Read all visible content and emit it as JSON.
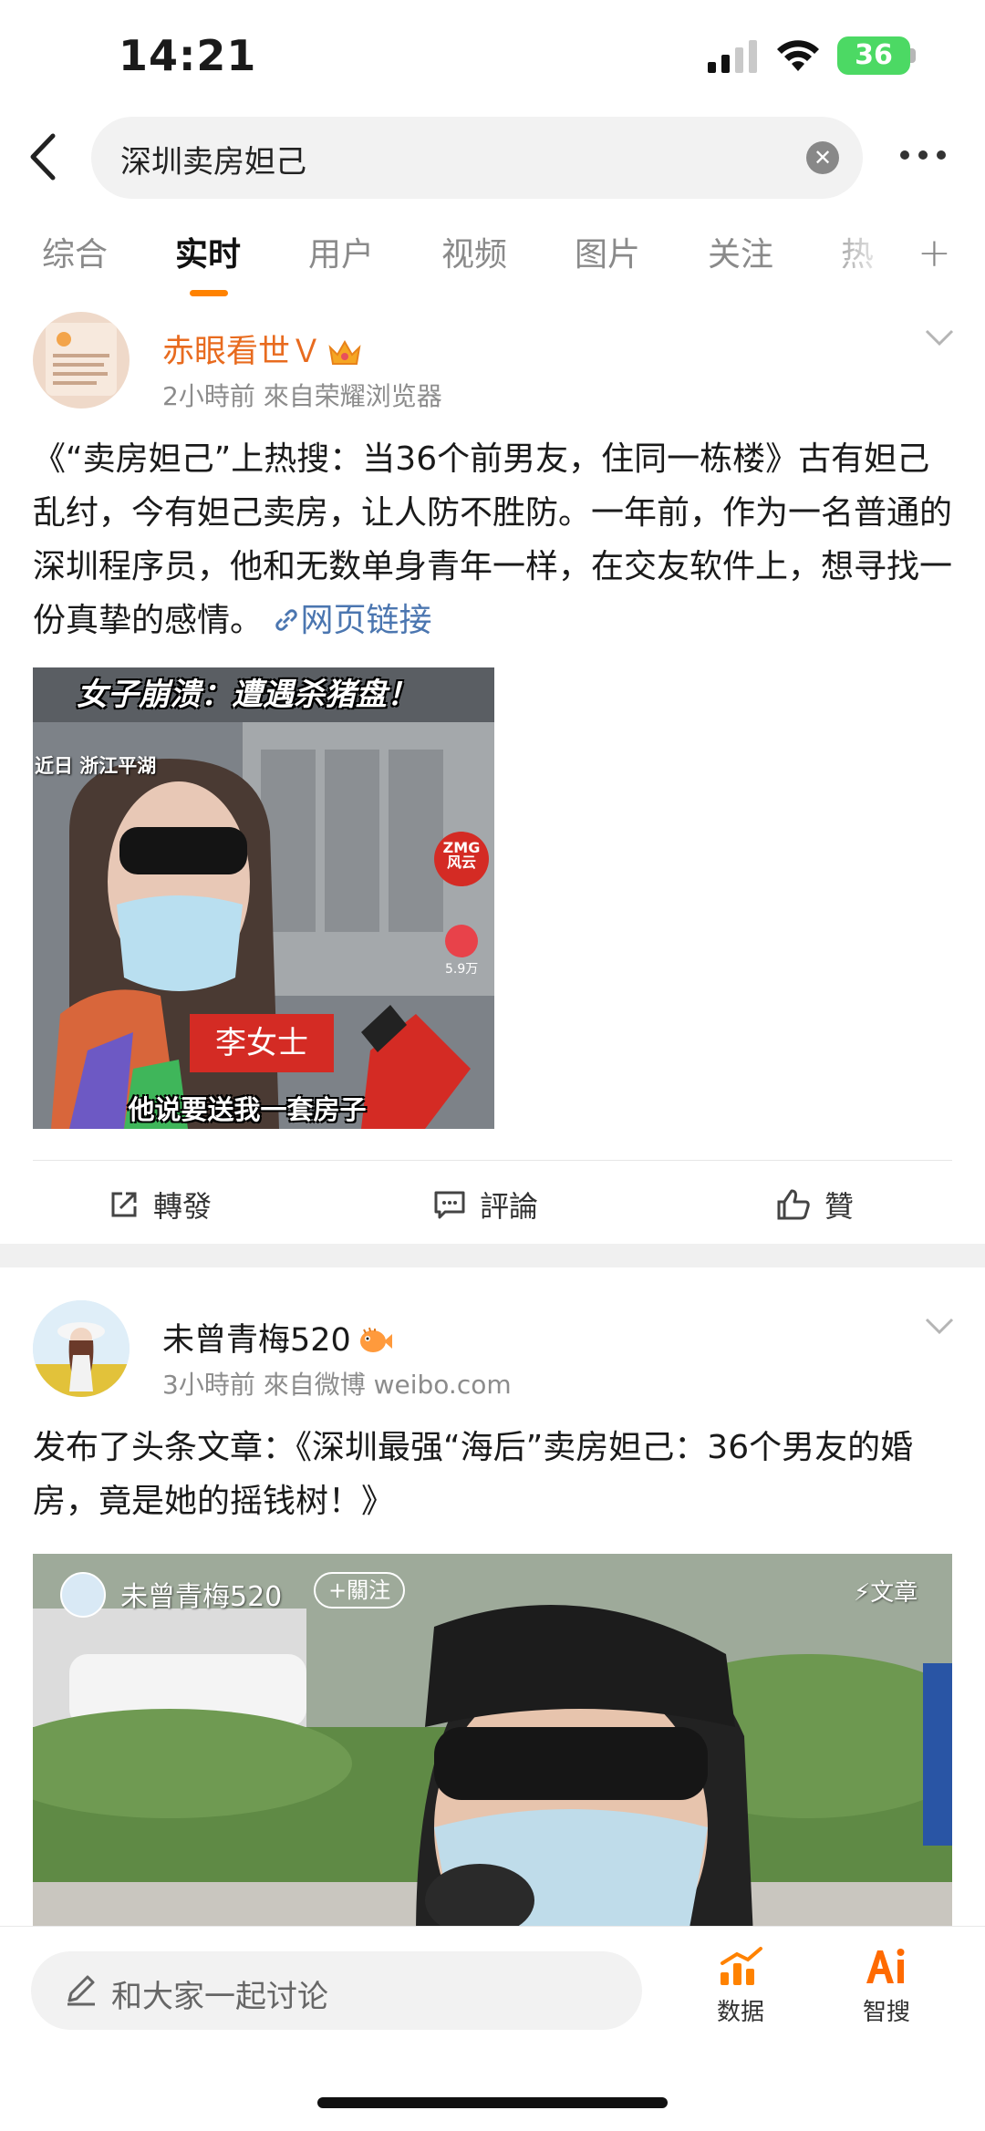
{
  "status_bar": {
    "time": "14:21",
    "battery": "36"
  },
  "search": {
    "query": "深圳卖房妲己",
    "clear_icon": "close-icon",
    "more_icon": "more-horizontal-icon"
  },
  "tabs": {
    "items": [
      {
        "label": "综合"
      },
      {
        "label": "实时"
      },
      {
        "label": "用户"
      },
      {
        "label": "视频"
      },
      {
        "label": "图片"
      },
      {
        "label": "关注"
      },
      {
        "label": "热"
      }
    ],
    "active_index": 1,
    "plus": "+"
  },
  "posts": [
    {
      "username": "赤眼看世Ｖ",
      "meta": "2小時前  來自荣耀浏览器",
      "text": "《“卖房妲己”上热搜：当36个前男友，住同一栋楼》古有妲己乱纣，今有妲己卖房，让人防不胜防。一年前，作为一名普通的深圳程序员，他和无数单身青年一样，在交友软件上，想寻找一份真挚的感情。",
      "link_label": "网页链接",
      "image": {
        "title": "女子崩溃：遭遇杀猪盘！",
        "place": "近日 浙江平湖",
        "name_badge": "李女士",
        "caption": "他说要送我一套房子",
        "badge": "ZMG 风云",
        "likes": "5.9万"
      },
      "actions": {
        "repost": "轉發",
        "comment": "評論",
        "like": "贊"
      }
    },
    {
      "username": "未曾青梅520",
      "meta": "3小時前  來自微博 weibo.com",
      "text": "发布了头条文章：《深圳最强“海后”卖房妲己：36个男友的婚房，竟是她的摇钱树！》",
      "media": {
        "overlay_name": "未曾青梅520",
        "follow_label": "+關注",
        "article_label": "⚡文章"
      }
    }
  ],
  "bottom_bar": {
    "comment_placeholder": "和大家一起讨论",
    "data_label": "数据",
    "ai_label": "智搜",
    "accent": "#ff8200"
  }
}
